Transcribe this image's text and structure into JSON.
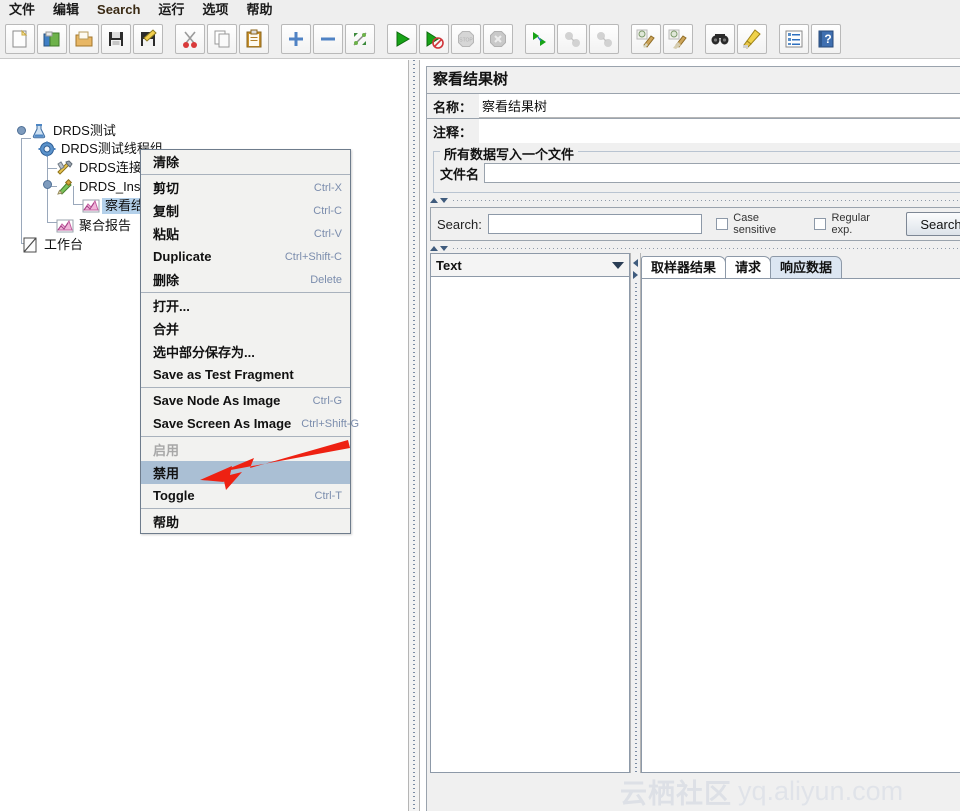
{
  "menubar": {
    "items": [
      {
        "label": "文件",
        "latin": false
      },
      {
        "label": "编辑",
        "latin": false
      },
      {
        "label": "Search",
        "latin": true
      },
      {
        "label": "运行",
        "latin": false
      },
      {
        "label": "选项",
        "latin": false
      },
      {
        "label": "帮助",
        "latin": false
      }
    ]
  },
  "toolbar": {
    "buttons": [
      {
        "name": "new-icon",
        "title": "新建"
      },
      {
        "name": "templates-icon",
        "title": "模板"
      },
      {
        "name": "open-icon",
        "title": "打开"
      },
      {
        "name": "save-icon",
        "title": "保存"
      },
      {
        "name": "save-as-icon",
        "title": "保存为"
      },
      {
        "name": "cut-icon",
        "title": "剪切"
      },
      {
        "name": "copy-icon",
        "title": "复制"
      },
      {
        "name": "paste-icon",
        "title": "粘贴"
      },
      {
        "name": "expand-all-icon",
        "title": "展开全部"
      },
      {
        "name": "collapse-all-icon",
        "title": "折叠全部"
      },
      {
        "name": "toggle-icon",
        "title": "Toggle"
      },
      {
        "name": "start-icon",
        "title": "启动"
      },
      {
        "name": "start-no-pauses-icon",
        "title": "无暂停启动"
      },
      {
        "name": "stop-icon",
        "title": "停止"
      },
      {
        "name": "shutdown-icon",
        "title": "关闭"
      },
      {
        "name": "remote-start-all-icon",
        "title": "远程全部启动"
      },
      {
        "name": "remote-stop-all-icon",
        "title": "远程全部停止"
      },
      {
        "name": "remote-shutdown-all-icon",
        "title": "远程全部关闭"
      },
      {
        "name": "clear-icon",
        "title": "清除"
      },
      {
        "name": "clear-all-icon",
        "title": "清除全部"
      },
      {
        "name": "search-icon",
        "title": "查找"
      },
      {
        "name": "search-reset-icon",
        "title": "重置查找"
      },
      {
        "name": "function-helper-icon",
        "title": "函数助手对话框"
      },
      {
        "name": "help-icon",
        "title": "帮助"
      }
    ]
  },
  "tree": {
    "nodes": [
      {
        "label": "DRDS测试",
        "icon": "test-plan-icon",
        "depth": 0,
        "selected": false
      },
      {
        "label": "DRDS测试线程组",
        "icon": "thread-group-icon",
        "depth": 1,
        "selected": false
      },
      {
        "label": "DRDS连接配置",
        "icon": "config-element-icon",
        "depth": 2,
        "selected": false
      },
      {
        "label": "DRDS_Insert",
        "icon": "jdbc-request-icon",
        "depth": 2,
        "selected": false
      },
      {
        "label": "察看结果树",
        "icon": "listener-icon",
        "depth": 3,
        "selected": true
      },
      {
        "label": "聚合报告",
        "icon": "listener-icon",
        "depth": 2,
        "selected": false
      },
      {
        "label": "工作台",
        "icon": "workbench-icon",
        "depth": 0,
        "selected": false
      }
    ]
  },
  "context_menu": {
    "groups": [
      [
        {
          "label": "清除",
          "accel": "",
          "cjk": true,
          "state": "normal"
        }
      ],
      [
        {
          "label": "剪切",
          "accel": "Ctrl-X",
          "cjk": true,
          "state": "normal"
        },
        {
          "label": "复制",
          "accel": "Ctrl-C",
          "cjk": true,
          "state": "normal"
        },
        {
          "label": "粘贴",
          "accel": "Ctrl-V",
          "cjk": true,
          "state": "normal"
        },
        {
          "label": "Duplicate",
          "accel": "Ctrl+Shift-C",
          "cjk": false,
          "state": "normal"
        },
        {
          "label": "删除",
          "accel": "Delete",
          "cjk": true,
          "state": "normal"
        }
      ],
      [
        {
          "label": "打开...",
          "accel": "",
          "cjk": true,
          "state": "normal"
        },
        {
          "label": "合并",
          "accel": "",
          "cjk": true,
          "state": "normal"
        },
        {
          "label": "选中部分保存为...",
          "accel": "",
          "cjk": true,
          "state": "normal"
        },
        {
          "label": "Save as Test Fragment",
          "accel": "",
          "cjk": false,
          "state": "normal"
        }
      ],
      [
        {
          "label": "Save Node As Image",
          "accel": "Ctrl-G",
          "cjk": false,
          "state": "normal"
        },
        {
          "label": "Save Screen As Image",
          "accel": "Ctrl+Shift-G",
          "cjk": false,
          "state": "normal"
        }
      ],
      [
        {
          "label": "启用",
          "accel": "",
          "cjk": true,
          "state": "disabled"
        },
        {
          "label": "禁用",
          "accel": "",
          "cjk": true,
          "state": "highlighted"
        },
        {
          "label": "Toggle",
          "accel": "Ctrl-T",
          "cjk": false,
          "state": "normal"
        }
      ],
      [
        {
          "label": "帮助",
          "accel": "",
          "cjk": true,
          "state": "normal"
        }
      ]
    ]
  },
  "right_panel": {
    "title": "察看结果树",
    "name_label": "名称：",
    "name_value": "察看结果树",
    "comment_label": "注释：",
    "comment_value": "",
    "group_title": "所有数据写入一个文件",
    "file_label": "文件名",
    "file_value": "",
    "search": {
      "label": "Search:",
      "value": "",
      "case_sensitive_label": "Case sensitive",
      "case_sensitive_checked": false,
      "regular_exp_label": "Regular exp.",
      "regular_exp_checked": false,
      "button_label": "Search"
    },
    "renderer": {
      "selected": "Text"
    },
    "tabs": [
      {
        "label": "取样器结果",
        "active": false
      },
      {
        "label": "请求",
        "active": false
      },
      {
        "label": "响应数据",
        "active": true
      }
    ]
  },
  "watermark": {
    "cjk": "云栖社区",
    "latin": "yq.aliyun.com"
  },
  "colors": {
    "selection_blue": "#b3d0ea",
    "menu_highlight": "#aabfd4",
    "accel_text": "#7b8dad",
    "arrow_red": "#ee2112",
    "active_tab": "#dce6f2"
  }
}
